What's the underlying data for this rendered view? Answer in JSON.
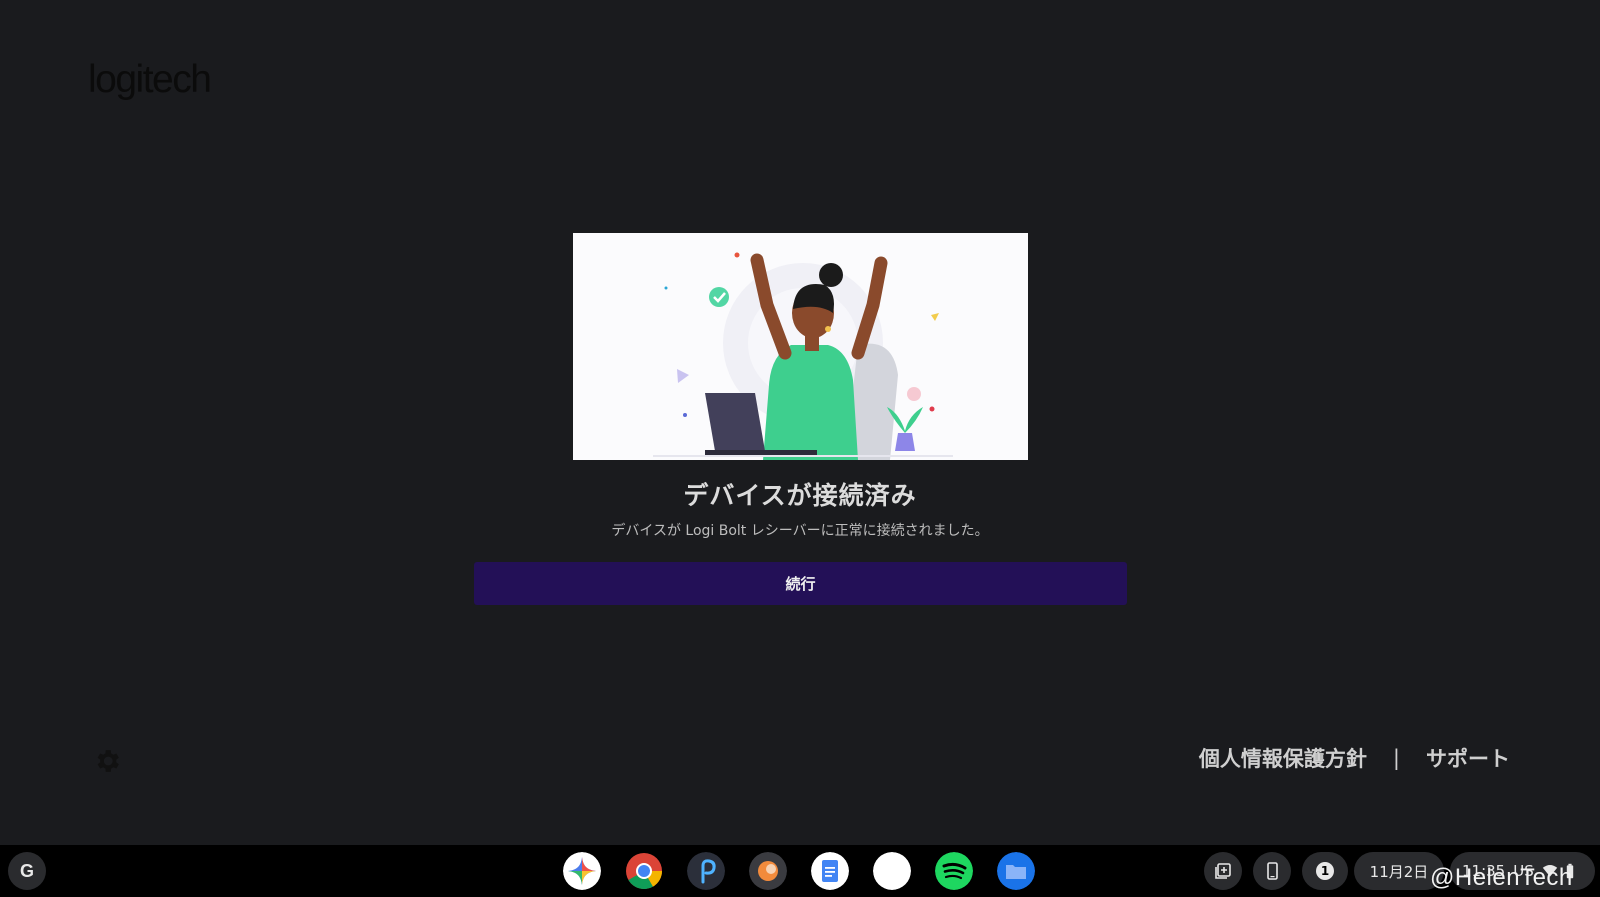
{
  "app": {
    "logo_text": "logitech",
    "title": "デバイスが接続済み",
    "subtitle": "デバイスが Logi Bolt レシーバーに正常に接続されました。",
    "continue_label": "続行",
    "footer": {
      "privacy_label": "個人情報保護方針",
      "separator": "|",
      "support_label": "サポート"
    },
    "icons": {
      "settings": "gear-icon"
    },
    "colors": {
      "background": "#1a1b1e",
      "button": "#231057",
      "accent_green": "#3ecf8e"
    }
  },
  "shelf": {
    "launcher_label": "G",
    "apps": [
      "gemini-icon",
      "chrome-icon",
      "picsart-icon",
      "photos-icon",
      "docs-icon",
      "blank-app-icon",
      "spotify-icon",
      "files-icon"
    ],
    "tray": {
      "notification_count": "1",
      "date": "11月2日",
      "time": "11:35",
      "ime": "US"
    }
  },
  "watermark": "@HelenTech"
}
